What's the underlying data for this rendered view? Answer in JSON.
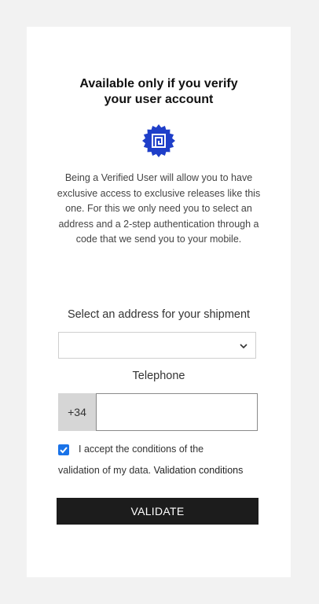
{
  "verify": {
    "title": "Available only if you verify\nyour user account",
    "badge_icon": "verified-badge-icon",
    "badge_color": "#1f3fc9",
    "description": "Being a Verified User will allow you to have exclusive access to exclusive releases like this one. For this we only need you to select an address and a 2-step authentication through a code that we send you to your mobile."
  },
  "address": {
    "label": "Select an address for your shipment",
    "selected_value": "",
    "chevron_icon": "chevron-down-icon"
  },
  "telephone": {
    "label": "Telephone",
    "prefix": "+34",
    "value": "",
    "placeholder": ""
  },
  "conditions": {
    "checked": true,
    "text_line1": "I accept the conditions of the",
    "text_line2": "validation of my data.",
    "link_text": "Validation conditions",
    "checkbox_color": "#1a73e8"
  },
  "actions": {
    "validate_label": "VALIDATE"
  }
}
